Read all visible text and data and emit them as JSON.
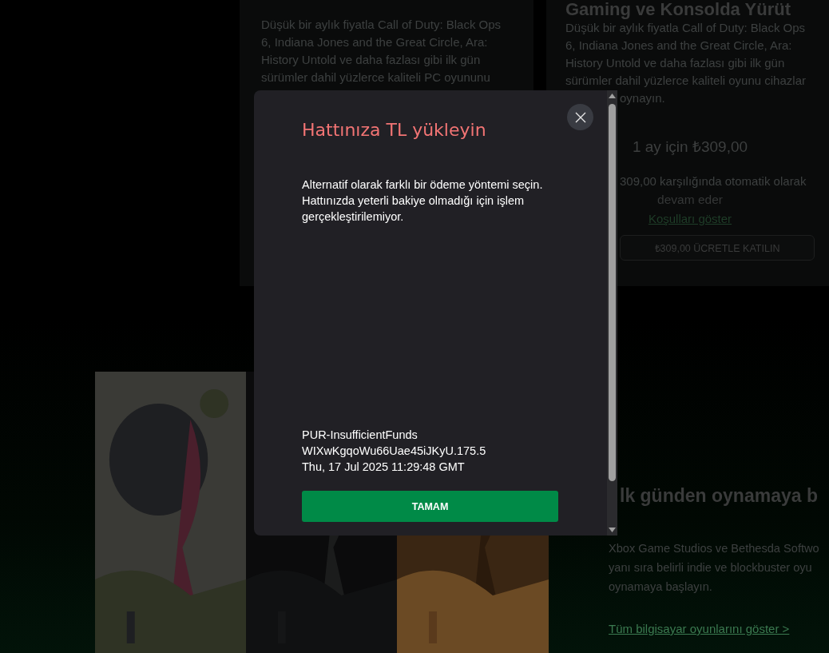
{
  "background": {
    "cards": [
      {
        "kind": "plain",
        "lines": [
          "Düşük bir aylık fiyatla Call of Duty: Black Ops",
          "6, Indiana Jones and the Great Circle, Ara:",
          "History Untold ve daha fazlası gibi ilk gün",
          "sürümler dahil yüzlerce kaliteli PC oyununu"
        ]
      },
      {
        "kind": "offer",
        "heading": "Gaming ve Konsolda Yürüt",
        "lines": [
          "Düşük bir aylık fiyatla Call of Duty: Black Ops",
          "6, Indiana Jones and the Great Circle, Ara:",
          "History Untold ve daha fazlası gibi ilk gün",
          "sürümler dahil yüzlerce kaliteli oyunu cihazlar"
        ],
        "tail_line": "oynayın.",
        "price": "1 ay için ₺309,00",
        "renewal": [
          "309,00 karşılığında otomatik olarak",
          "devam eder"
        ],
        "terms_link": "Koşulları göster",
        "join_button": "₺309,00 ÜCRETLE KATILIN"
      }
    ],
    "promo": {
      "heading": "lk günden oynamaya b",
      "lines": [
        "Xbox Game Studios ve Bethesda Softwo",
        "yanı sıra belirli indie ve blockbuster oyu",
        "oynamaya başlayın."
      ],
      "link": "Tüm bilgisayar oyunlarını göster >"
    }
  },
  "dialog": {
    "title": "Hattınıza TL yükleyin",
    "message": "Alternatif olarak farklı bir ödeme yöntemi seçin. Hattınızda yeterli bakiye olmadığı için işlem gerçekleştirilemiyor.",
    "error_lines": [
      "PUR-InsufficientFunds",
      "WIXwKgqoWu66Uae45iJKyU.175.5",
      "Thu, 17 Jul 2025 11:29:48 GMT"
    ],
    "ok_button": "TAMAM"
  }
}
